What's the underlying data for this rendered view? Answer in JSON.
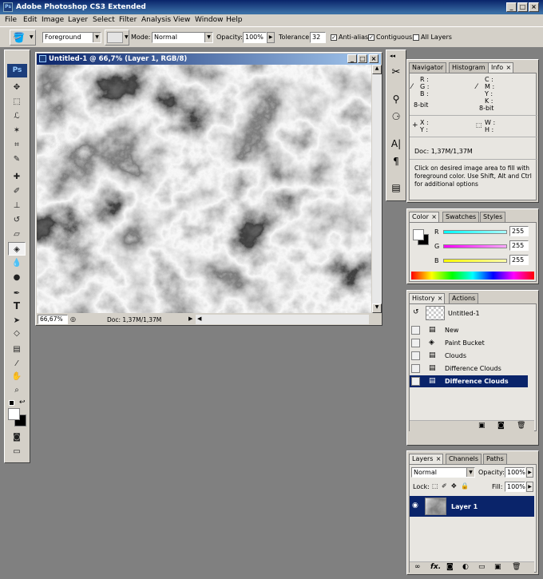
{
  "app": {
    "title": "Adobe Photoshop CS3 Extended"
  },
  "menu": [
    "File",
    "Edit",
    "Image",
    "Layer",
    "Select",
    "Filter",
    "Analysis",
    "View",
    "Window",
    "Help"
  ],
  "options": {
    "fill_source": "Foreground",
    "mode_label": "Mode:",
    "mode_value": "Normal",
    "opacity_label": "Opacity:",
    "opacity_value": "100%",
    "tolerance_label": "Tolerance:",
    "tolerance_value": "32",
    "antialias_label": "Anti-alias",
    "contiguous_label": "Contiguous",
    "all_layers_label": "All Layers"
  },
  "toolbox": {
    "logo": "Ps",
    "tools": [
      "move-icon",
      "marquee-icon",
      "lasso-icon",
      "magic-wand-icon",
      "crop-icon",
      "slice-icon",
      "healing-brush-icon",
      "brush-icon",
      "clone-stamp-icon",
      "history-brush-icon",
      "eraser-icon",
      "paint-bucket-icon",
      "blur-icon",
      "dodge-icon",
      "pen-icon",
      "type-icon",
      "path-selection-icon",
      "shape-icon",
      "notes-icon",
      "eyedropper-icon",
      "hand-icon",
      "zoom-icon"
    ]
  },
  "document": {
    "title": "Untitled-1 @ 66,7% (Layer 1, RGB/8)",
    "zoom": "66,67%",
    "doc_size": "Doc: 1,37M/1,37M"
  },
  "info_panel": {
    "tabs": [
      "Navigator",
      "Histogram",
      "Info"
    ],
    "active_tab": "Info",
    "r": "R :",
    "g": "G :",
    "b": "B :",
    "c": "C :",
    "m": "M :",
    "y": "Y :",
    "k": "K :",
    "bitdepth_left": "8-bit",
    "bitdepth_right": "8-bit",
    "x": "X :",
    "yy": "Y :",
    "w": "W :",
    "h": "H :",
    "doc": "Doc: 1,37M/1,37M",
    "hint": "Click on desired image area to fill with foreground color.  Use Shift, Alt and Ctrl for additional options"
  },
  "color_panel": {
    "tabs": [
      "Color",
      "Swatches",
      "Styles"
    ],
    "active_tab": "Color",
    "channels": [
      {
        "label": "R",
        "value": "255",
        "color": "#00e5ee"
      },
      {
        "label": "G",
        "value": "255",
        "color": "#ff00ff"
      },
      {
        "label": "B",
        "value": "255",
        "color": "#ffff00"
      }
    ]
  },
  "history_panel": {
    "tabs": [
      "History",
      "Actions"
    ],
    "active_tab": "History",
    "snapshot": "Untitled-1",
    "steps": [
      {
        "label": "New",
        "icon": "document-icon"
      },
      {
        "label": "Paint Bucket",
        "icon": "paint-bucket-icon"
      },
      {
        "label": "Clouds",
        "icon": "document-icon"
      },
      {
        "label": "Difference Clouds",
        "icon": "document-icon"
      },
      {
        "label": "Difference Clouds",
        "icon": "document-icon"
      }
    ],
    "selected_index": 4
  },
  "layers_panel": {
    "tabs": [
      "Layers",
      "Channels",
      "Paths"
    ],
    "active_tab": "Layers",
    "blend_mode": "Normal",
    "opacity_label": "Opacity:",
    "opacity_value": "100%",
    "lock_label": "Lock:",
    "fill_label": "Fill:",
    "fill_value": "100%",
    "layers": [
      {
        "name": "Layer 1",
        "visible": true
      }
    ],
    "footer_fx": "fx."
  }
}
